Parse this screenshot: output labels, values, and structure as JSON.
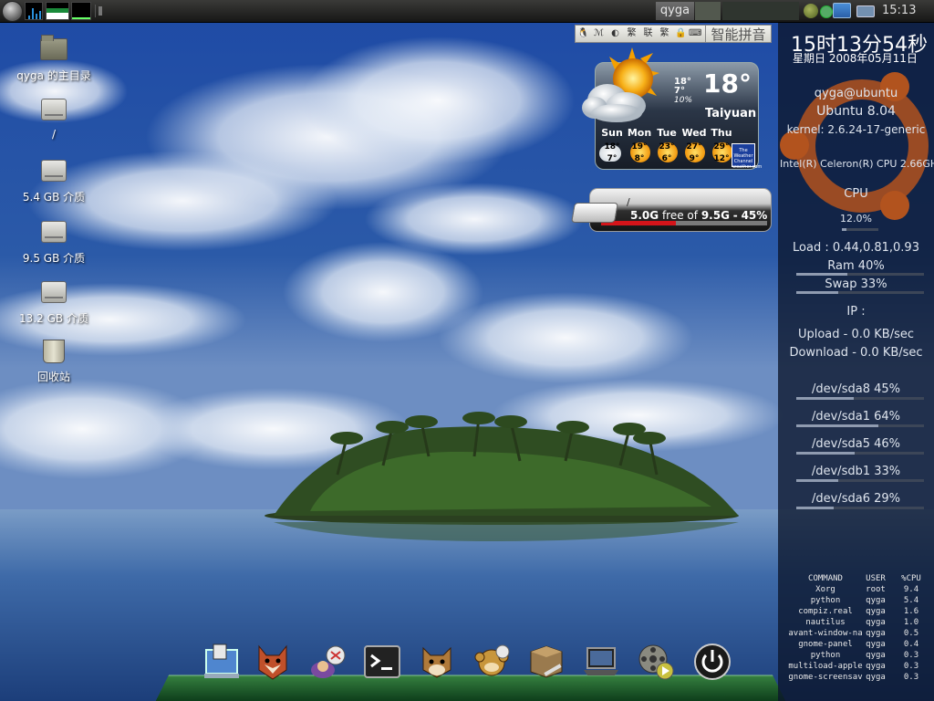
{
  "top_panel": {
    "user_switcher": "qyga",
    "clock": "15:13"
  },
  "ime": {
    "name": "智能拼音",
    "buttons": [
      "🐧",
      "ℳ",
      "◐",
      "繁",
      "联",
      "繁",
      "🔒",
      "⌨"
    ]
  },
  "desktop_icons": [
    {
      "label": "qyga 的主目录",
      "icon": "home-folder-icon"
    },
    {
      "label": "/",
      "icon": "drive-icon"
    },
    {
      "label": "5.4 GB 介质",
      "icon": "drive-icon"
    },
    {
      "label": "9.5 GB 介质",
      "icon": "drive-icon"
    },
    {
      "label": "13.2 GB 介质",
      "icon": "drive-icon"
    },
    {
      "label": "回收站",
      "icon": "trash-icon"
    }
  ],
  "weather": {
    "high": "18°",
    "low": "7°",
    "humidity": "10%",
    "current_temp": "18°",
    "city": "Taiyuan",
    "forecast": [
      {
        "day": "Sun",
        "high": "18°",
        "low": "7°",
        "icon": "cloudy-sun"
      },
      {
        "day": "Mon",
        "high": "19°",
        "low": "8°",
        "icon": "sunny"
      },
      {
        "day": "Tue",
        "high": "23°",
        "low": "6°",
        "icon": "sunny"
      },
      {
        "day": "Wed",
        "high": "27°",
        "low": "9°",
        "icon": "sunny"
      },
      {
        "day": "Thu",
        "high": "29°",
        "low": "12°",
        "icon": "sunny"
      }
    ],
    "logo_text": "The Weather Channel weather.com"
  },
  "disk": {
    "mount": "/",
    "free": "5.0G",
    "free_of": "free of",
    "total": "9.5G",
    "separator": "-",
    "used_percent": "45%",
    "used_fraction": 0.45
  },
  "conky": {
    "time": "15时13分54秒",
    "date": "星期日  2008年05月11日",
    "user_host": "qyga@ubuntu",
    "distro": "Ubuntu 8.04",
    "kernel": "kernel: 2.6.24-17-generic",
    "cpu_model": "Intel(R) Celeron(R) CPU 2.66GHz",
    "cpu_label": "CPU",
    "cpu_percent": "12.0%",
    "cpu_fraction": 0.12,
    "load": "Load : 0.44,0.81,0.93",
    "ram": "Ram 40%",
    "ram_fraction": 0.4,
    "swap": "Swap 33%",
    "swap_fraction": 0.33,
    "ip": "IP :",
    "upload": "Upload - 0.0 KB/sec",
    "download": "Download - 0.0 KB/sec",
    "disks": [
      {
        "label": "/dev/sda8 45%",
        "fraction": 0.45
      },
      {
        "label": "/dev/sda1 64%",
        "fraction": 0.64
      },
      {
        "label": "/dev/sda5 46%",
        "fraction": 0.46
      },
      {
        "label": "/dev/sdb1 33%",
        "fraction": 0.33
      },
      {
        "label": "/dev/sda6 29%",
        "fraction": 0.29
      }
    ],
    "proc_header": {
      "command": "COMMAND",
      "user": "USER",
      "cpu": "%CPU"
    },
    "processes": [
      {
        "command": "Xorg",
        "user": "root",
        "cpu": "9.4"
      },
      {
        "command": "python",
        "user": "qyga",
        "cpu": "5.4"
      },
      {
        "command": "compiz.real",
        "user": "qyga",
        "cpu": "1.6"
      },
      {
        "command": "nautilus",
        "user": "qyga",
        "cpu": "1.0"
      },
      {
        "command": "avant-window-na",
        "user": "qyga",
        "cpu": "0.5"
      },
      {
        "command": "gnome-panel",
        "user": "qyga",
        "cpu": "0.4"
      },
      {
        "command": "python",
        "user": "qyga",
        "cpu": "0.3"
      },
      {
        "command": "multiload-apple",
        "user": "qyga",
        "cpu": "0.3"
      },
      {
        "command": "gnome-screensav",
        "user": "qyga",
        "cpu": "0.3"
      }
    ]
  },
  "dock": [
    {
      "name": "show-desktop-icon",
      "color": "#3a70c0"
    },
    {
      "name": "firefox-fox-icon",
      "color": "#b8452a"
    },
    {
      "name": "pidgin-messenger-icon",
      "color": "#7b5a9a"
    },
    {
      "name": "terminal-icon",
      "color": "#2a2a2a"
    },
    {
      "name": "gnome-cat-icon",
      "color": "#9a6a2a"
    },
    {
      "name": "monkey-mascot-icon",
      "color": "#b38a3a"
    },
    {
      "name": "package-manager-icon",
      "color": "#8a6a3e"
    },
    {
      "name": "laptop-icon",
      "color": "#4b4b4b"
    },
    {
      "name": "media-player-icon",
      "color": "#8a8a7a"
    },
    {
      "name": "power-button-icon",
      "color": "#1a1a1a"
    }
  ]
}
